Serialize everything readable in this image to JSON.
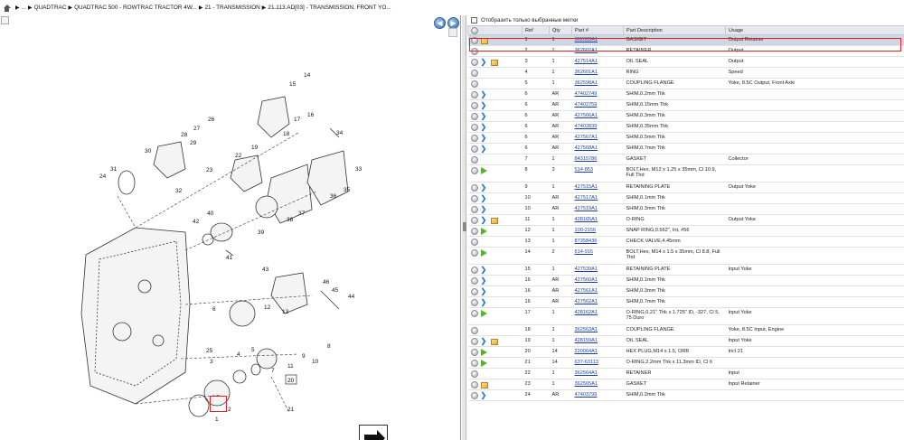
{
  "breadcrumb": {
    "items": [
      "...",
      "QUADTRAC",
      "QUADTRAC 500 - ROWTRAC TRACTOR 4W...",
      "21 - TRANSMISSION",
      "21.113.AD[03] - TRANSMISSION, FRONT YO..."
    ]
  },
  "filter": {
    "label": "Отобразить только выбранные метки",
    "checked": false
  },
  "table": {
    "headers": [
      "",
      "Ref",
      "Qty",
      "Part #",
      "Part Description",
      "Usage"
    ],
    "rows": [
      {
        "icons": [
          "circle",
          "cube"
        ],
        "ref": "1",
        "qty": "1",
        "part": "362603A1",
        "desc": "GASKET",
        "usage": "Output Retainer",
        "selected": true
      },
      {
        "icons": [
          "circle"
        ],
        "ref": "2",
        "qty": "1",
        "part": "362602A1",
        "desc": "RETAINER",
        "usage": "Output"
      },
      {
        "icons": [
          "circle",
          "info",
          "cube"
        ],
        "ref": "3",
        "qty": "1",
        "part": "427514A1",
        "desc": "OIL SEAL",
        "usage": "Output"
      },
      {
        "icons": [
          "circle"
        ],
        "ref": "4",
        "qty": "1",
        "part": "362601A1",
        "desc": "RING",
        "usage": "Speed"
      },
      {
        "icons": [
          "circle"
        ],
        "ref": "5",
        "qty": "1",
        "part": "362598A1",
        "desc": "COUPLING FLANGE",
        "usage": "Yoke, 8.5C Output, Front Axle"
      },
      {
        "icons": [
          "circle",
          "info"
        ],
        "ref": "6",
        "qty": "AR",
        "part": "47402749",
        "desc": "SHIM,0.2mm Thk",
        "usage": ""
      },
      {
        "icons": [
          "circle",
          "info"
        ],
        "ref": "6",
        "qty": "AR",
        "part": "47402759",
        "desc": "SHIM,0.15mm Thk",
        "usage": ""
      },
      {
        "icons": [
          "circle",
          "info"
        ],
        "ref": "6",
        "qty": "AR",
        "part": "427566A1",
        "desc": "SHIM,0.3mm Thk",
        "usage": ""
      },
      {
        "icons": [
          "circle",
          "info"
        ],
        "ref": "6",
        "qty": "AR",
        "part": "47402839",
        "desc": "SHIM,0.35mm Thk",
        "usage": ""
      },
      {
        "icons": [
          "circle",
          "info"
        ],
        "ref": "6",
        "qty": "AR",
        "part": "427567A1",
        "desc": "SHIM,0.5mm Thk",
        "usage": ""
      },
      {
        "icons": [
          "circle",
          "info"
        ],
        "ref": "6",
        "qty": "AR",
        "part": "427568A1",
        "desc": "SHIM,0.7mm Thk",
        "usage": ""
      },
      {
        "icons": [
          "circle"
        ],
        "ref": "7",
        "qty": "1",
        "part": "84315786",
        "desc": "GASKET",
        "usage": "Collector"
      },
      {
        "icons": [
          "circle",
          "arrow"
        ],
        "ref": "8",
        "qty": "3",
        "part": "514-853",
        "desc": "BOLT,Hex, M12 x 1.25 x 35mm, Cl 10.9, Full Thd",
        "usage": "",
        "tall": true
      },
      {
        "icons": [
          "circle",
          "info"
        ],
        "ref": "9",
        "qty": "1",
        "part": "427515A1",
        "desc": "RETAINING PLATE",
        "usage": "Output Yoke"
      },
      {
        "icons": [
          "circle",
          "info"
        ],
        "ref": "10",
        "qty": "AR",
        "part": "427517A1",
        "desc": "SHIM,0.1mm Thk",
        "usage": ""
      },
      {
        "icons": [
          "circle",
          "info"
        ],
        "ref": "10",
        "qty": "AR",
        "part": "427519A1",
        "desc": "SHIM,0.3mm Thk",
        "usage": ""
      },
      {
        "icons": [
          "circle",
          "info",
          "cube"
        ],
        "ref": "11",
        "qty": "1",
        "part": "428165A1",
        "desc": "O-RING",
        "usage": "Output Yoke"
      },
      {
        "icons": [
          "circle",
          "arrow"
        ],
        "ref": "12",
        "qty": "1",
        "part": "100-2156",
        "desc": "SNAP RING,0.562\", Int, #56",
        "usage": ""
      },
      {
        "icons": [
          "circle"
        ],
        "ref": "13",
        "qty": "1",
        "part": "87358436",
        "desc": "CHECK VALVE,4.45mm",
        "usage": ""
      },
      {
        "icons": [
          "circle",
          "arrow"
        ],
        "ref": "14",
        "qty": "2",
        "part": "514-915",
        "desc": "BOLT,Hex, M14 x 1.5 x 35mm, Cl 8.8, Full Thd",
        "usage": "",
        "tall": true
      },
      {
        "icons": [
          "circle",
          "info"
        ],
        "ref": "15",
        "qty": "1",
        "part": "427539A1",
        "desc": "RETAINING PLATE",
        "usage": "Input Yoke"
      },
      {
        "icons": [
          "circle",
          "info"
        ],
        "ref": "16",
        "qty": "AR",
        "part": "427560A1",
        "desc": "SHIM,0.1mm Thk",
        "usage": ""
      },
      {
        "icons": [
          "circle",
          "info"
        ],
        "ref": "16",
        "qty": "AR",
        "part": "427561A1",
        "desc": "SHIM,0.3mm Thk",
        "usage": ""
      },
      {
        "icons": [
          "circle",
          "info"
        ],
        "ref": "16",
        "qty": "AR",
        "part": "427562A1",
        "desc": "SHIM,0.7mm Thk",
        "usage": ""
      },
      {
        "icons": [
          "circle",
          "arrow"
        ],
        "ref": "17",
        "qty": "1",
        "part": "428162A1",
        "desc": "O-RING,0.21\" Thk x 1.725\" ID, -327, Cl 5, 75 Duro",
        "usage": "Input Yoke",
        "tall": true
      },
      {
        "icons": [
          "circle"
        ],
        "ref": "18",
        "qty": "1",
        "part": "362563A1",
        "desc": "COUPLING FLANGE",
        "usage": "Yoke, 8.5C Input, Engine"
      },
      {
        "icons": [
          "circle",
          "info",
          "cube"
        ],
        "ref": "19",
        "qty": "1",
        "part": "428159A1",
        "desc": "OIL SEAL",
        "usage": "Input Yoke"
      },
      {
        "icons": [
          "circle",
          "arrow"
        ],
        "ref": "20",
        "qty": "14",
        "part": "220064A1",
        "desc": "HEX PLUG,M14 x 1.5, ORB",
        "usage": "Incl 21"
      },
      {
        "icons": [
          "circle",
          "arrow"
        ],
        "ref": "21",
        "qty": "14",
        "part": "637-63113",
        "desc": "O-RING,2.2mm Thk x 11.3mm ID, Cl 6",
        "usage": ""
      },
      {
        "icons": [
          "circle"
        ],
        "ref": "22",
        "qty": "1",
        "part": "362564A1",
        "desc": "RETAINER",
        "usage": "Input"
      },
      {
        "icons": [
          "circle",
          "cube"
        ],
        "ref": "23",
        "qty": "1",
        "part": "362565A1",
        "desc": "GASKET",
        "usage": "Input Retainer"
      },
      {
        "icons": [
          "circle",
          "info"
        ],
        "ref": "24",
        "qty": "AR",
        "part": "47403799",
        "desc": "SHIM,0.2mm Thk",
        "usage": ""
      }
    ]
  },
  "diagram": {
    "callouts": [
      "1",
      "2",
      "3",
      "4",
      "5",
      "6",
      "7",
      "8",
      "9",
      "10",
      "11",
      "12",
      "13",
      "14",
      "15",
      "16",
      "17",
      "18",
      "19",
      "20",
      "21",
      "22",
      "23",
      "24",
      "25",
      "26",
      "27",
      "28",
      "29",
      "30",
      "31",
      "32",
      "33",
      "34",
      "35",
      "36",
      "37",
      "38",
      "39",
      "40",
      "41",
      "42",
      "43",
      "44",
      "45",
      "46"
    ]
  }
}
